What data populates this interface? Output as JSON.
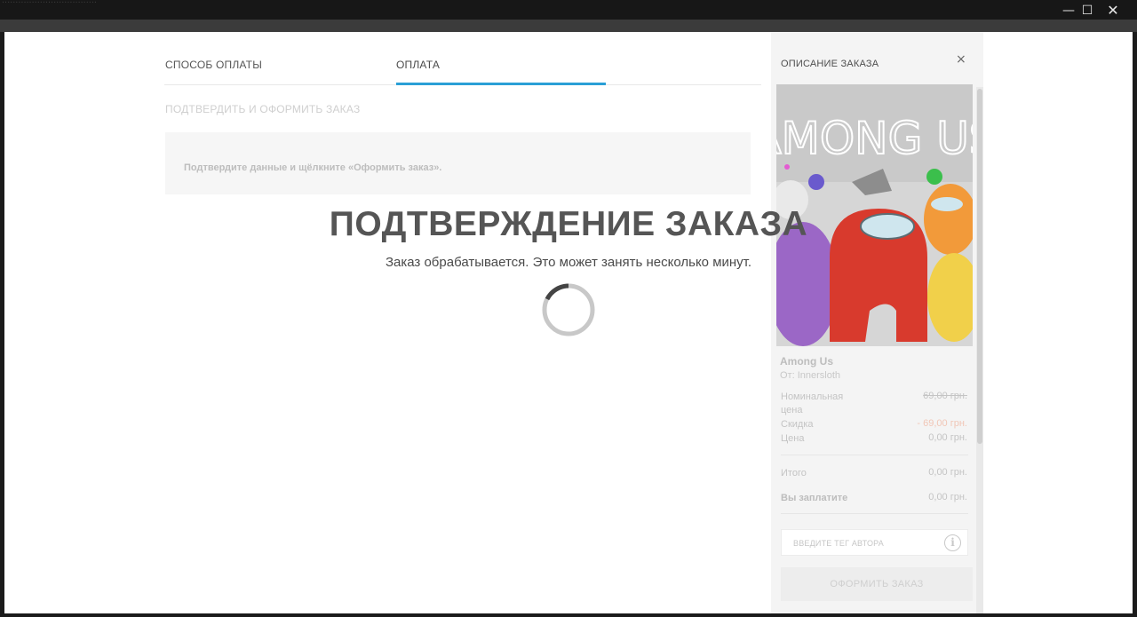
{
  "window": {
    "ghost_title": "...................................",
    "minimize_glyph": "—",
    "maximize_glyph": "☐",
    "close_glyph": "✕"
  },
  "checkout": {
    "tabs": [
      {
        "label": "СПОСОБ ОПЛАТЫ",
        "active": false
      },
      {
        "label": "ОПЛАТА",
        "active": true
      }
    ],
    "step3": "ПОДТВЕРДИТЬ И ОФОРМИТЬ ЗАКАЗ",
    "info": "Подтвердите данные и щёлкните «Оформить заказ».",
    "accent_color": "#2a9fd6"
  },
  "overlay": {
    "title": "ПОДТВЕРЖДЕНИЕ ЗАКАЗА",
    "subtitle": "Заказ обрабатывается. Это может занять несколько минут."
  },
  "sidebar": {
    "title": "ОПИСАНИЕ ЗАКАЗА",
    "close_glyph": "×",
    "game": {
      "name": "Among Us",
      "publisher": "От: Innersloth",
      "art_title": "AMONG US"
    },
    "rows": {
      "base_price_label": "Номинальная цена",
      "base_price_value": "69,00 грн.",
      "discount_label": "Скидка",
      "discount_value": "- 69,00 грн.",
      "price_label": "Цена",
      "price_value": "0,00 грн.",
      "total_label": "Итого",
      "total_value": "0,00 грн.",
      "pay_label": "Вы заплатите",
      "pay_value": "0,00 грн."
    },
    "tag_placeholder": "ВВЕДИТЕ ТЕГ АВТОРА",
    "info_glyph": "i",
    "order_button": "ОФОРМИТЬ ЗАКАЗ"
  }
}
